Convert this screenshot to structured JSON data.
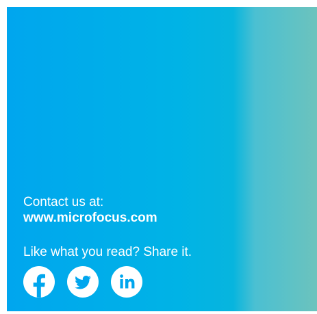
{
  "card": {
    "contact_label": "Contact us at:",
    "contact_url": "www.microfocus.com",
    "share_text": "Like what you read? Share it."
  },
  "social": [
    {
      "icon": "facebook-icon"
    },
    {
      "icon": "twitter-icon"
    },
    {
      "icon": "linkedin-icon"
    }
  ],
  "colors": {
    "gradient_start": "#00a6ee",
    "gradient_end": "#6cc3bd",
    "text": "#ffffff"
  }
}
